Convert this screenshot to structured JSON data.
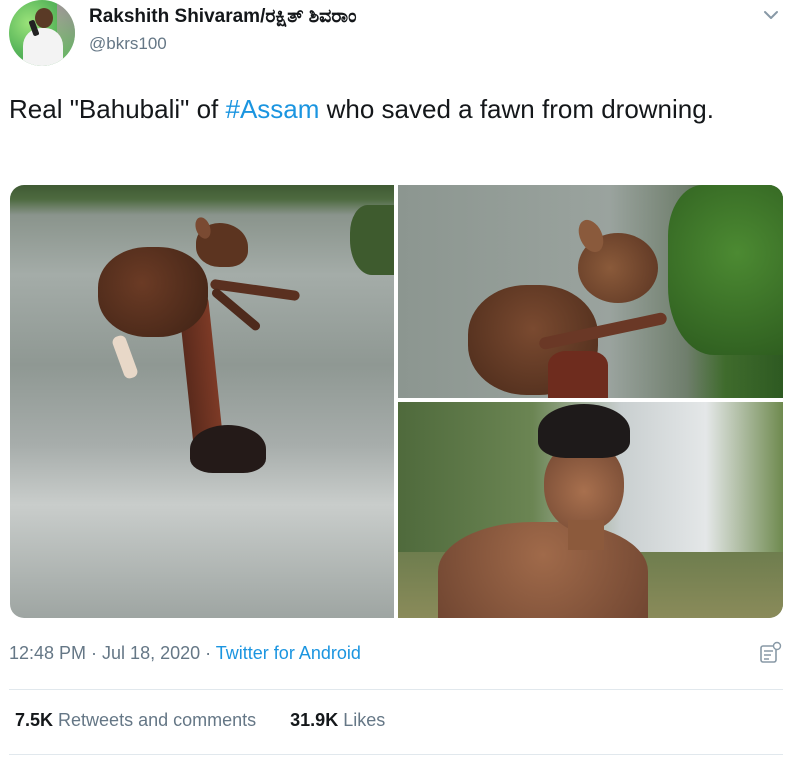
{
  "colors": {
    "link": "#1b95e0",
    "text_primary": "#14171a",
    "text_secondary": "#657786",
    "divider": "#e1e8ed"
  },
  "tweet": {
    "author_name": "Rakshith Shivaram/ರಕ್ಷಿತ್ ಶಿವರಾಂ",
    "author_handle": "@bkrs100",
    "text_before": "Real \"Bahubali\" of ",
    "hashtag": "#Assam",
    "text_after": " who saved a fawn from drowning.",
    "timestamp": "12:48 PM · Jul 18, 2020",
    "separator": " · ",
    "source": "Twitter for Android",
    "retweets_count": "7.5K",
    "retweets_label": " Retweets and comments",
    "likes_count": "31.9K",
    "likes_label": " Likes"
  },
  "icons": {
    "menu": "chevron-down-icon",
    "analytics": "analytics-icon"
  }
}
